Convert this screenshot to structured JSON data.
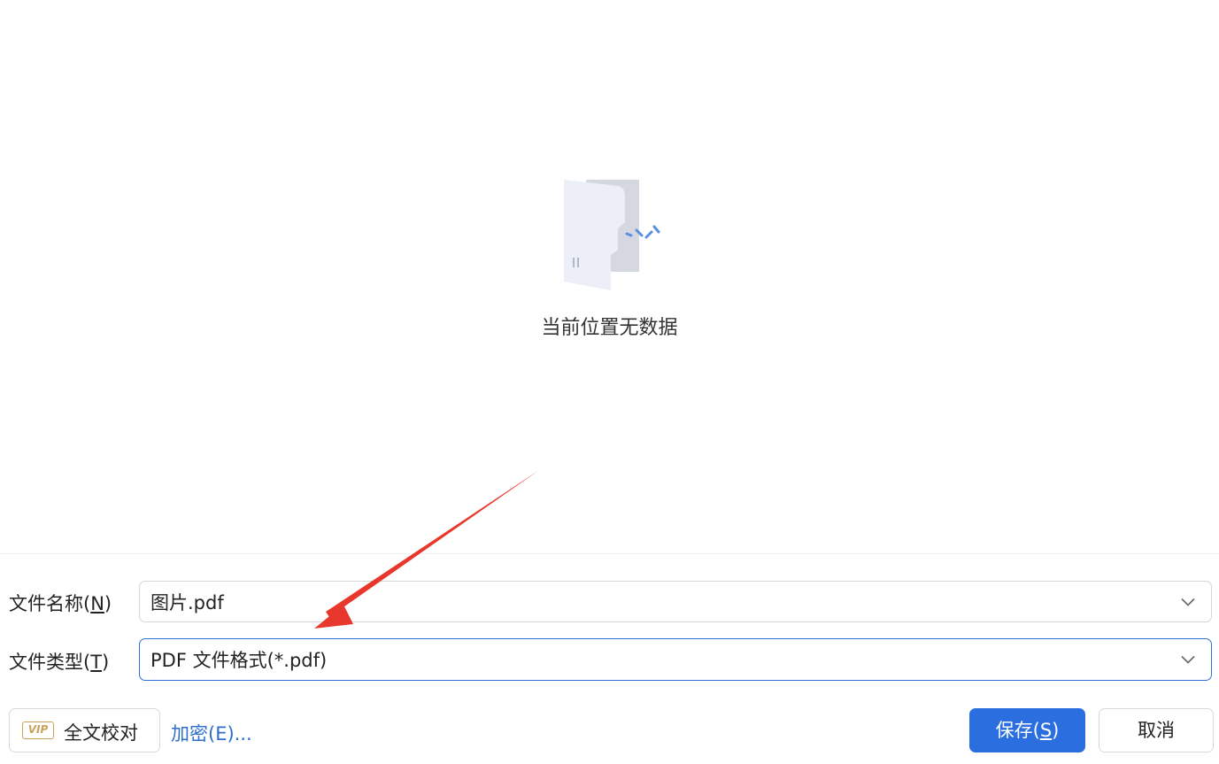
{
  "empty_state": {
    "message": "当前位置无数据",
    "icon": "empty-folder-icon"
  },
  "form": {
    "filename": {
      "label_text": "文件名称(",
      "label_key": "N",
      "label_end": ")",
      "value": "图片.pdf"
    },
    "filetype": {
      "label_text": "文件类型(",
      "label_key": "T",
      "label_end": ")",
      "value": "PDF 文件格式(*.pdf)"
    }
  },
  "footer": {
    "proofread_button": {
      "badge": "VIP",
      "label": "全文校对"
    },
    "encrypt_link": "加密(E)...",
    "save_button": {
      "label_text": "保存(",
      "label_key": "S",
      "label_end": ")"
    },
    "cancel_button": "取消"
  },
  "annotation": {
    "arrow_color": "#e8372c"
  },
  "colors": {
    "accent": "#2b6ee0",
    "link": "#2b6fcf",
    "vip_gold": "#c9a15a",
    "focus_border": "#2f6fd3"
  }
}
